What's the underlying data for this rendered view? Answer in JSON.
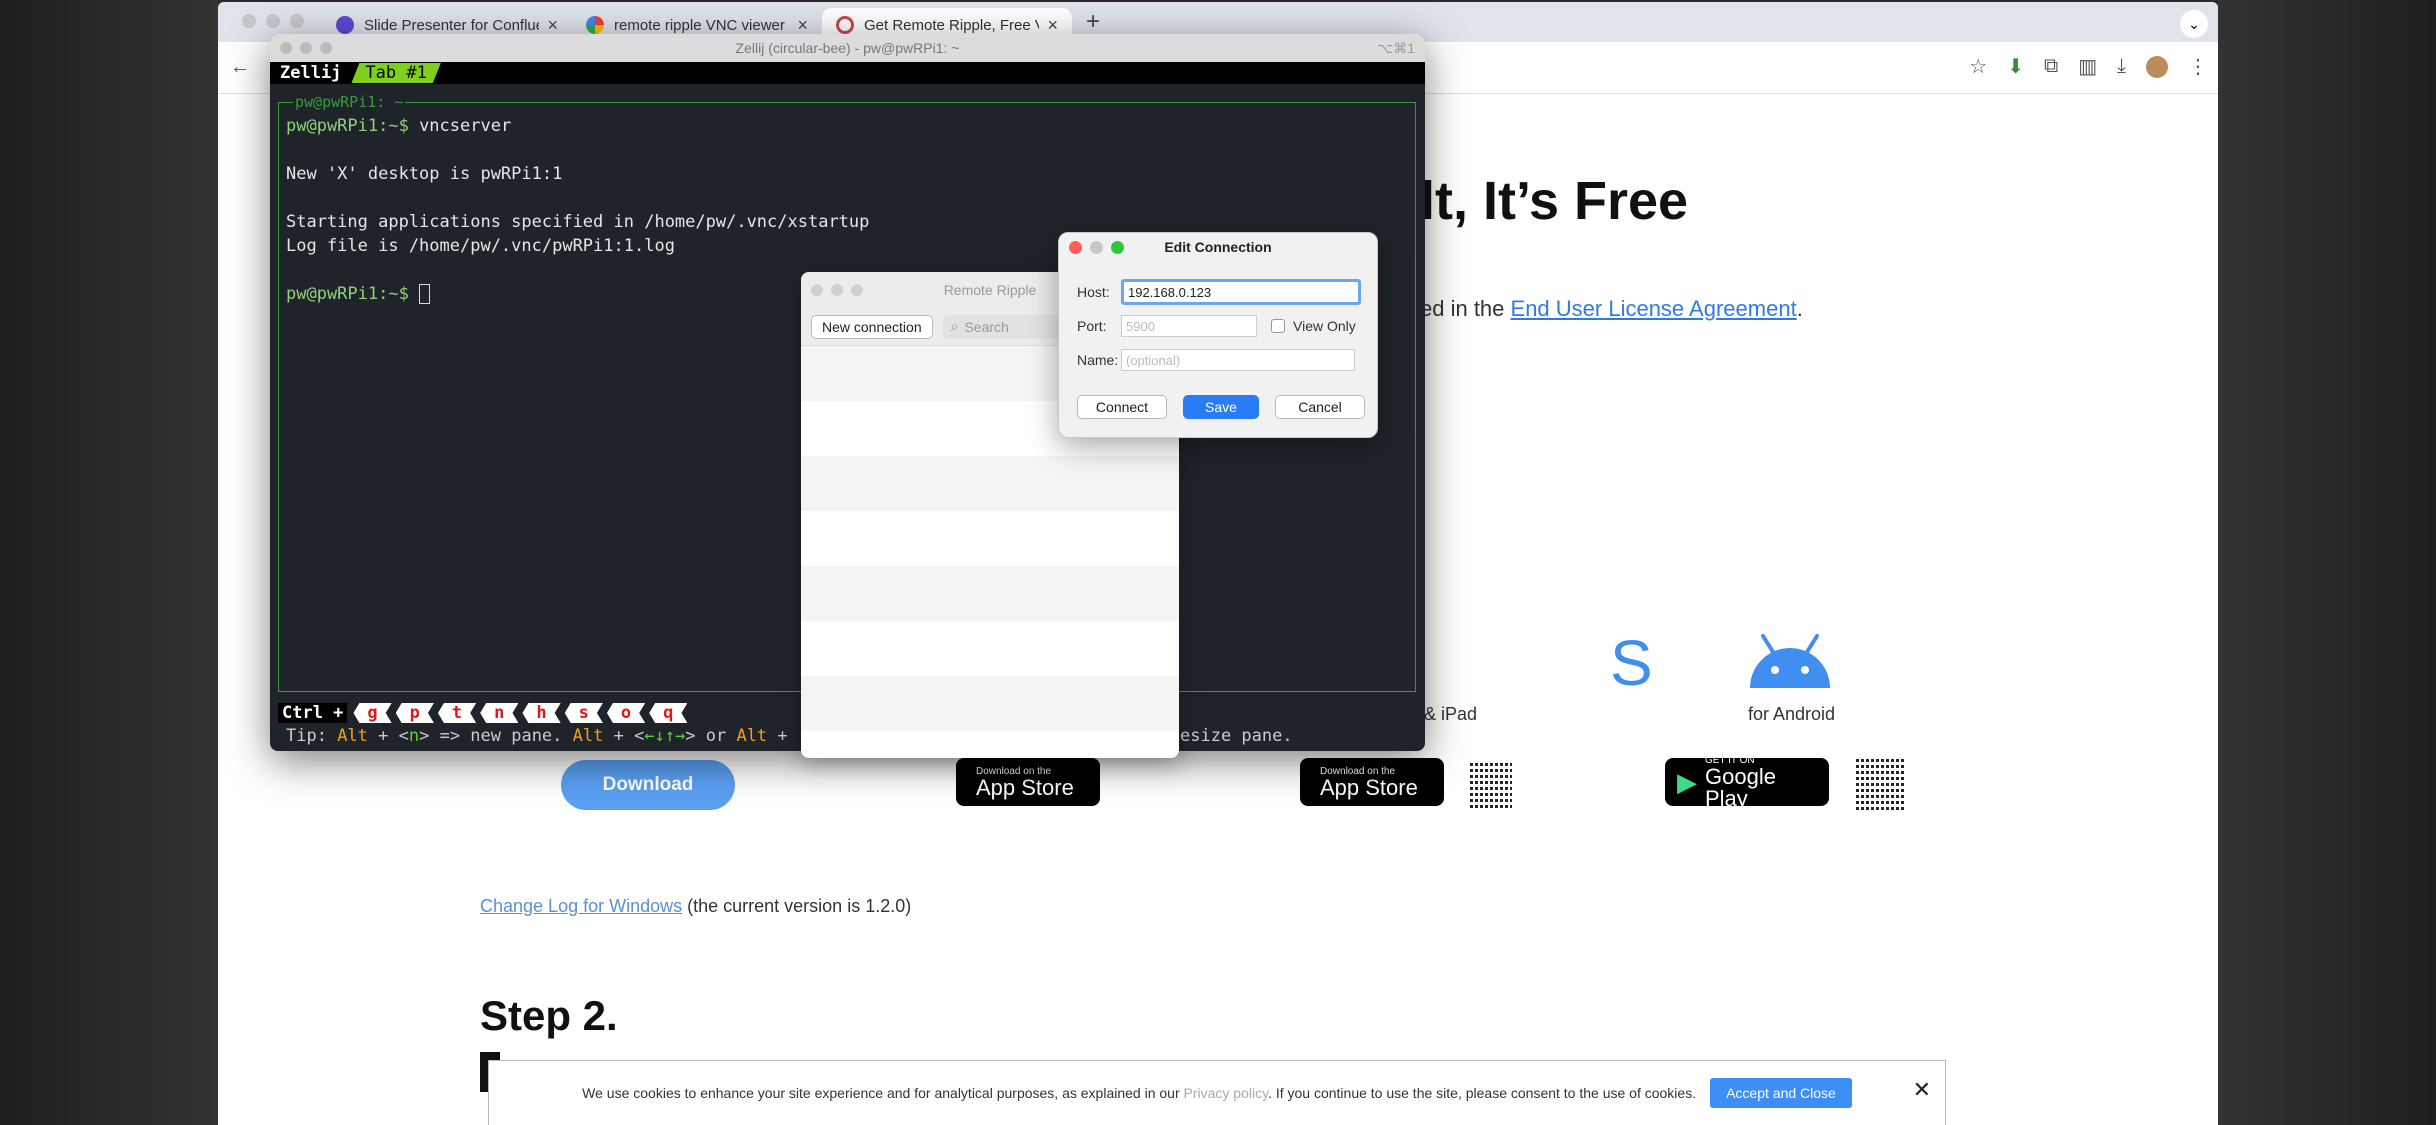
{
  "browser": {
    "tabs": [
      {
        "title": "Slide Presenter for Confluence",
        "color": "#5b4bd6"
      },
      {
        "title": "remote ripple VNC viewer - G",
        "color": "#4285f4"
      },
      {
        "title": "Get Remote Ripple, Free VNC",
        "color": "#c74949"
      }
    ],
    "new_tab": "+",
    "tab_menu": "⌄"
  },
  "page": {
    "hero_title": "lt, It’s Free",
    "license_prefix": "ed in the ",
    "license_link": "End User License Agreement",
    "license_suffix": ".",
    "platform_ios": "& iPad",
    "platform_android": "for Android",
    "download_label": "Download",
    "appstore_small": "Download on the",
    "appstore_big": "App Store",
    "google_small": "GET IT ON",
    "google_big": "Google Play",
    "changelog_link": "Change Log for Windows",
    "changelog_rest": " (the current version is 1.2.0)",
    "step2": "Step 2."
  },
  "cookie": {
    "text1": "We use cookies to enhance your site experience and for analytical purposes, as explained in our ",
    "policy": "Privacy policy",
    "text2": ". If you continue to use the site, please consent to the use of cookies.",
    "accept": "Accept and Close",
    "close": "✕"
  },
  "terminal": {
    "title": "Zellij (circular-bee) - pw@pwRPi1: ~",
    "shortcut": "⌥⌘1",
    "session": "Zellij",
    "tab": "Tab #1",
    "pane_title": "pw@pwRPi1: ~",
    "prompt": "pw@pwRPi1:~$",
    "cmd": " vncserver",
    "line2": "New 'X' desktop is pwRPi1:1",
    "line3": "Starting applications specified in /home/pw/.vnc/xstartup",
    "line4": "Log file is /home/pw/.vnc/pwRPi1:1.log",
    "ctrl": "Ctrl +",
    "keys": [
      "g",
      "p",
      "t",
      "n",
      "h",
      "s",
      "o",
      "q"
    ],
    "tip_label": "Tip: ",
    "tip_alt": "Alt",
    "tip_a": " + <",
    "tip_n": "n",
    "tip_b": "> => new pane. ",
    "tip_c": " + <",
    "tip_arrows": "←↓↑→",
    "tip_d": "> or ",
    "tip_e": " +",
    "tip_tail": "esize pane."
  },
  "remote_ripple": {
    "title": "Remote Ripple",
    "new_connection": "New connection",
    "search_placeholder": "Search"
  },
  "edit_connection": {
    "title": "Edit Connection",
    "host_label": "Host:",
    "host_value": "192.168.0.123",
    "port_label": "Port:",
    "port_placeholder": "5900",
    "view_only": "View Only",
    "name_label": "Name:",
    "name_placeholder": "(optional)",
    "connect": "Connect",
    "save": "Save",
    "cancel": "Cancel"
  }
}
